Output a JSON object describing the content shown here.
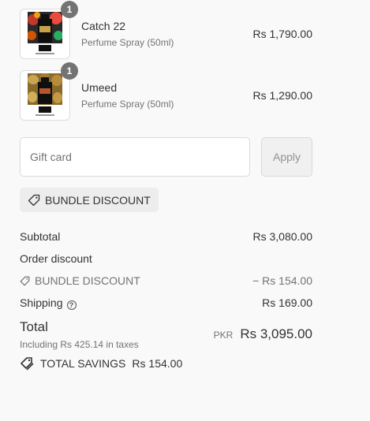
{
  "items": [
    {
      "name": "Catch 22",
      "variant": "Perfume Spray (50ml)",
      "price": "Rs 1,790.00",
      "quantity": "1",
      "thumbnail": "perfume-bottle-red-fruits"
    },
    {
      "name": "Umeed",
      "variant": "Perfume Spray (50ml)",
      "price": "Rs 1,290.00",
      "quantity": "1",
      "thumbnail": "perfume-bottle-potatoes"
    }
  ],
  "gift_card": {
    "placeholder": "Gift card",
    "apply_label": "Apply"
  },
  "discount_tag": {
    "label": "BUNDLE DISCOUNT",
    "icon": "tag-icon"
  },
  "summary": {
    "subtotal_label": "Subtotal",
    "subtotal_value": "Rs 3,080.00",
    "order_discount_label": "Order discount",
    "bundle_discount_label": "BUNDLE DISCOUNT",
    "bundle_discount_value": "− Rs 154.00",
    "shipping_label": "Shipping",
    "shipping_value": "Rs 169.00",
    "total_label": "Total",
    "tax_note": "Including Rs 425.14 in taxes",
    "currency": "PKR",
    "total_value": "Rs 3,095.00",
    "savings_label": "TOTAL SAVINGS",
    "savings_value": "Rs 154.00"
  },
  "colors": {
    "background": "#f9f9f9",
    "badge": "#737373",
    "muted_text": "#737373",
    "text": "#333333"
  }
}
